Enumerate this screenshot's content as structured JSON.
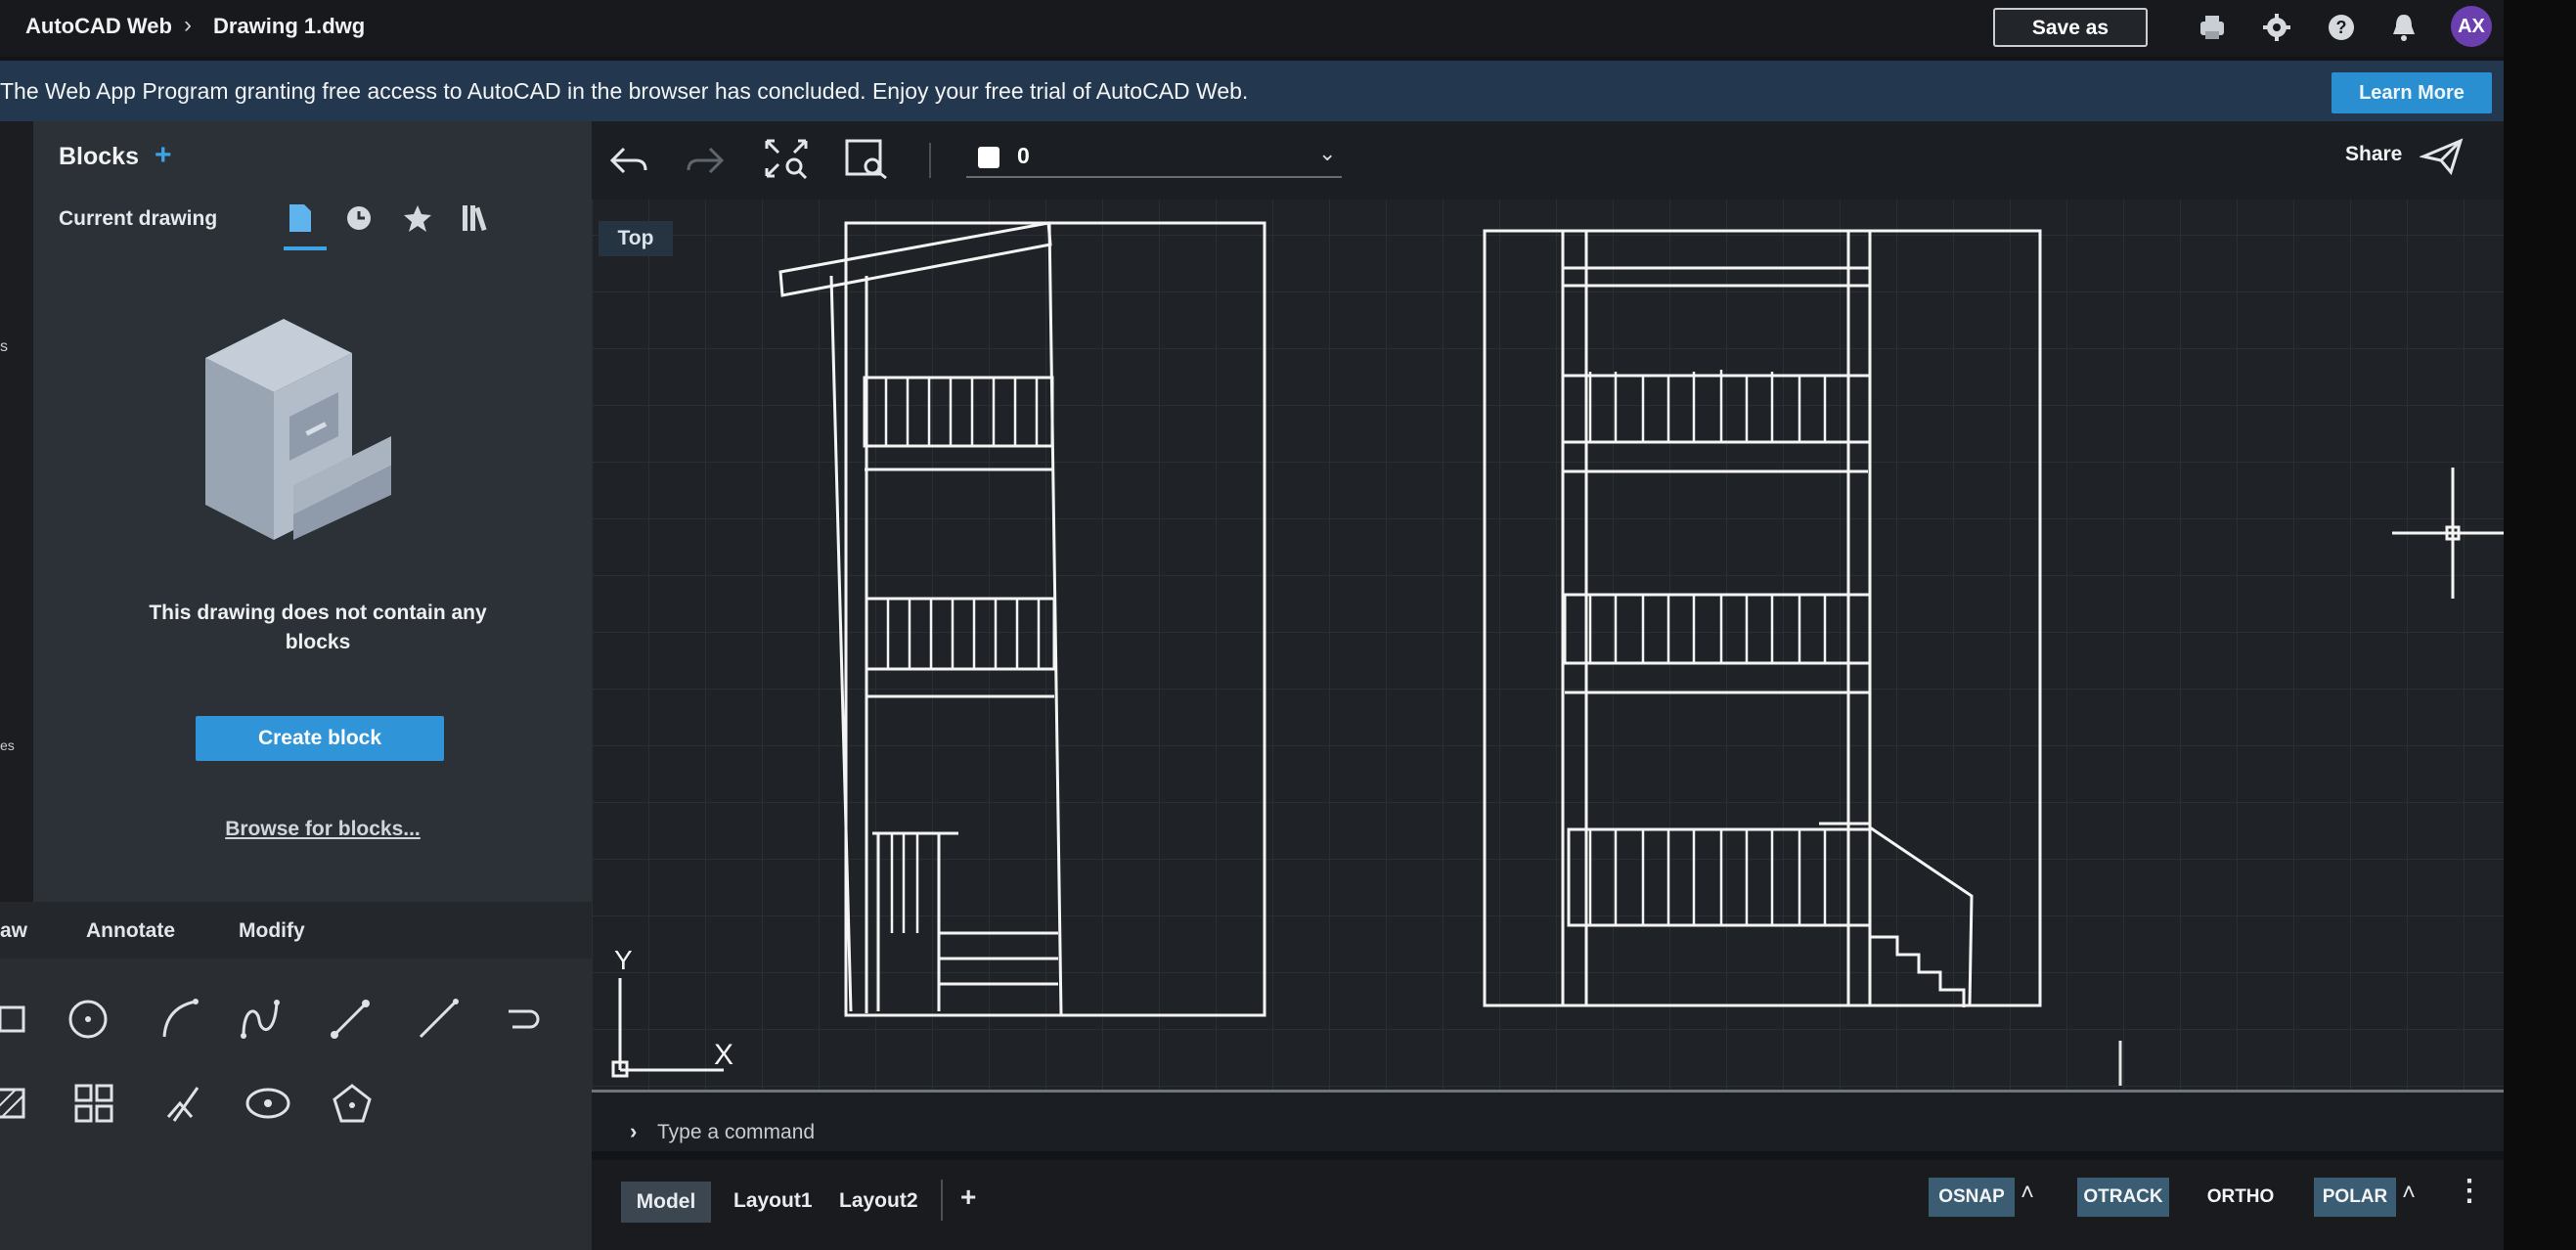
{
  "app": {
    "name": "AutoCAD Web",
    "file": "Drawing 1.dwg",
    "save_as": "Save as",
    "avatar": "AX"
  },
  "banner": {
    "text": "The Web App Program granting free access to AutoCAD in the browser has concluded. Enjoy your free trial of AutoCAD Web.",
    "button": "Learn More"
  },
  "blocks_panel": {
    "title": "Blocks",
    "current_drawing": "Current drawing",
    "empty_message_line1": "This drawing does not contain any",
    "empty_message_line2": "blocks",
    "create_block": "Create block",
    "browse": "Browse for blocks..."
  },
  "tool_tabs": {
    "draw": "aw",
    "annotate": "Annotate",
    "modify": "Modify"
  },
  "left_strip_text": {
    "t1": "s",
    "t2": "es"
  },
  "canvas": {
    "view_label": "Top",
    "layer_value": "0",
    "share": "Share",
    "ucs_x": "X",
    "ucs_y": "Y"
  },
  "command": {
    "placeholder": "Type a command"
  },
  "layouts": {
    "model": "Model",
    "layout1": "Layout1",
    "layout2": "Layout2"
  },
  "status": {
    "osnap": "OSNAP",
    "otrack": "OTRACK",
    "ortho": "ORTHO",
    "polar": "POLAR"
  },
  "colors": {
    "accent": "#2f95d8",
    "banner": "#23384e",
    "panel": "#2c3137",
    "canvas": "#1f2327"
  }
}
